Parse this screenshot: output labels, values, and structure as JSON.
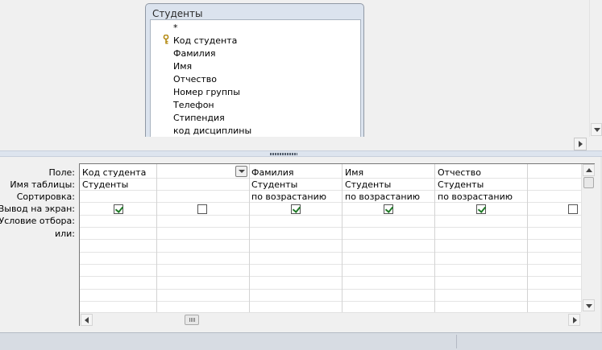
{
  "table_window": {
    "title": "Студенты",
    "fields": [
      "*",
      "Код студента",
      "Фамилия",
      "Имя",
      "Отчество",
      "Номер группы",
      "Телефон",
      "Стипендия",
      "код дисциплины"
    ],
    "primary_key_icon": "key-icon"
  },
  "grid": {
    "row_labels": {
      "field": "Поле:",
      "table": "Имя таблицы:",
      "sort": "Сортировка:",
      "show": "Вывод на экран:",
      "criteria": "Условие отбора:",
      "or": "или:"
    },
    "columns": [
      {
        "field": "Код студента",
        "table": "Студенты",
        "sort": "",
        "show": true
      },
      {
        "field": "",
        "table": "",
        "sort": "",
        "show": false,
        "has_dropdown": true
      },
      {
        "field": "Фамилия",
        "table": "Студенты",
        "sort": "по возрастанию",
        "show": true
      },
      {
        "field": "Имя",
        "table": "Студенты",
        "sort": "по возрастанию",
        "show": true
      },
      {
        "field": "Отчество",
        "table": "Студенты",
        "sort": "по возрастанию",
        "show": true
      },
      {
        "field": "",
        "table": "",
        "sort": "",
        "show": false
      }
    ]
  },
  "colors": {
    "table_window_bg": "#dbe3ee",
    "checkmark": "#1f7a27",
    "status_bar": "#d7dce3"
  }
}
